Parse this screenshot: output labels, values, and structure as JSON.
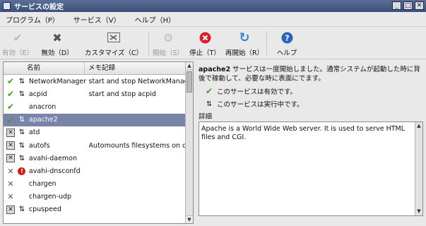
{
  "window": {
    "title": "サービスの設定",
    "controls": [
      "_",
      "□",
      "✕"
    ]
  },
  "menu": [
    "プログラム（P）",
    "サービス（V）",
    "ヘルプ（H）"
  ],
  "toolbar": {
    "enable": "有効（E）",
    "disable": "無効（D）",
    "customize": "カスタマイズ（C）",
    "start": "開始（S）",
    "stop": "停止（T）",
    "restart": "再開始（R）",
    "help": "ヘルプ"
  },
  "list": {
    "col_name": "名前",
    "col_desc": "メモ記録",
    "rows": [
      {
        "name": "NetworkManager",
        "desc": "start and stop NetworkManager",
        "enabled": "check",
        "running": "arrows"
      },
      {
        "name": "acpid",
        "desc": "start and stop acpid",
        "enabled": "check",
        "running": "arrows"
      },
      {
        "name": "anacron",
        "desc": "",
        "enabled": "check",
        "running": ""
      },
      {
        "name": "apache2",
        "desc": "",
        "enabled": "check",
        "running": "arrows",
        "selected": true
      },
      {
        "name": "atd",
        "desc": "",
        "enabled": "xbox",
        "running": "arrows"
      },
      {
        "name": "autofs",
        "desc": "Automounts filesystems on demand",
        "enabled": "xbox",
        "running": "arrows"
      },
      {
        "name": "avahi-daemon",
        "desc": "",
        "enabled": "xbox",
        "running": "arrows"
      },
      {
        "name": "avahi-dnsconfd",
        "desc": "",
        "enabled": "x",
        "running": "error"
      },
      {
        "name": "chargen",
        "desc": "",
        "enabled": "x",
        "running": ""
      },
      {
        "name": "chargen-udp",
        "desc": "",
        "enabled": "x",
        "running": ""
      },
      {
        "name": "cpuspeed",
        "desc": "",
        "enabled": "xbox",
        "running": "arrows"
      }
    ]
  },
  "detail": {
    "message_name": "apache2",
    "message_rest": " サービスは一度開始しました。通常システムが起動した時に背後で稼動して、必要な時に表面にでます。",
    "status_enabled": "このサービスは有効です。",
    "status_running": "このサービスは実行中です。",
    "desc_label": "詳細",
    "desc_text": "Apache is a World Wide Web server.  It is used to serve HTML files and CGI."
  },
  "colors": {
    "selection": "#7884a8",
    "ok": "#3e9c1e",
    "error": "#c81e1e",
    "restart": "#3b82c4",
    "help": "#2f63b8"
  }
}
